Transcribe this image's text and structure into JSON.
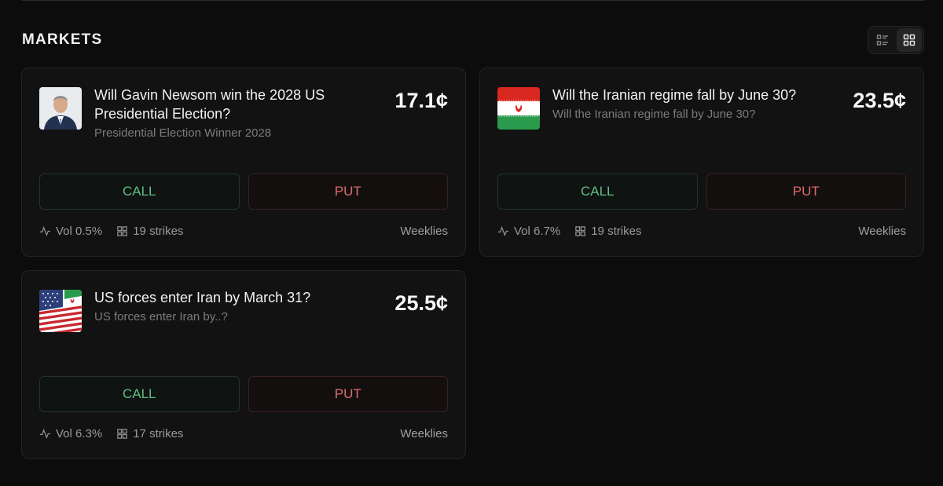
{
  "header": {
    "title": "MARKETS"
  },
  "view_toggle": {
    "options": [
      "list-view",
      "grid-view"
    ],
    "active": "grid-view"
  },
  "markets": [
    {
      "title": "Will Gavin Newsom win the 2028 US Presidential Election?",
      "subtitle": "Presidential Election Winner 2028",
      "price": "17.1¢",
      "call_label": "CALL",
      "put_label": "PUT",
      "vol": "Vol 0.5%",
      "strikes": "19 strikes",
      "expiry": "Weeklies"
    },
    {
      "title": "Will the Iranian regime fall by June 30?",
      "subtitle": "Will the Iranian regime fall by June 30?",
      "price": "23.5¢",
      "call_label": "CALL",
      "put_label": "PUT",
      "vol": "Vol 6.7%",
      "strikes": "19 strikes",
      "expiry": "Weeklies"
    },
    {
      "title": "US forces enter Iran by March 31?",
      "subtitle": "US forces enter Iran by..?",
      "price": "25.5¢",
      "call_label": "CALL",
      "put_label": "PUT",
      "vol": "Vol 6.3%",
      "strikes": "17 strikes",
      "expiry": "Weeklies"
    }
  ],
  "colors": {
    "background": "#0c0c0c",
    "card": "#121212",
    "call": "#5fbf84",
    "put": "#dd6a6a"
  }
}
